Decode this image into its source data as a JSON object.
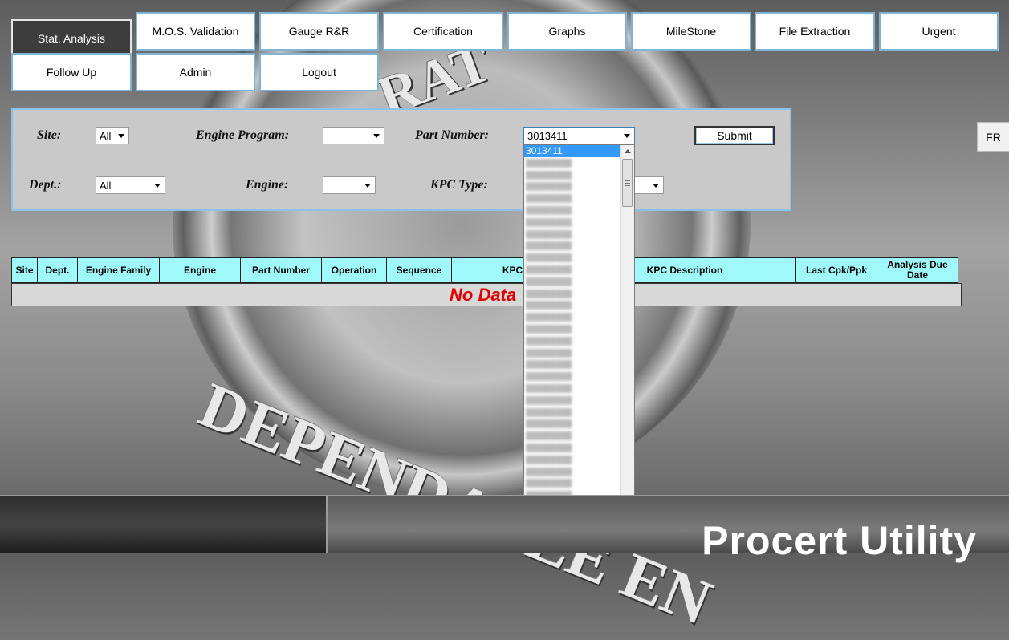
{
  "nav": {
    "row1": [
      "Stat. Analysis",
      "M.O.S. Validation",
      "Gauge R&R",
      "Certification",
      "Graphs",
      "MileStone",
      "File Extraction",
      "Urgent"
    ],
    "row2": [
      "Follow Up",
      "Admin",
      "Logout"
    ],
    "active": "Stat. Analysis"
  },
  "filters": {
    "site_label": "Site:",
    "site_value": "All",
    "engine_program_label": "Engine Program:",
    "engine_program_value": "",
    "part_number_label": "Part Number:",
    "part_number_value": "3013411",
    "dept_label": "Dept.:",
    "dept_value": "All",
    "engine_label": "Engine:",
    "engine_value": "",
    "kpc_type_label": "KPC Type:",
    "submit_label": "Submit"
  },
  "fr_label": "FR",
  "table": {
    "headers": [
      "Site",
      "Dept.",
      "Engine Family",
      "Engine",
      "Part Number",
      "Operation",
      "Sequence",
      "KPC",
      "KPC Description",
      "Last Cpk/Ppk",
      "Analysis Due Date"
    ],
    "empty_message": "No Data"
  },
  "part_dropdown": {
    "selected": "3013411"
  },
  "footer": {
    "title": "Procert Utility"
  },
  "background": {
    "emblem_text_bottom": "DEPENDABLE EN",
    "emblem_text_top": "RAT"
  }
}
